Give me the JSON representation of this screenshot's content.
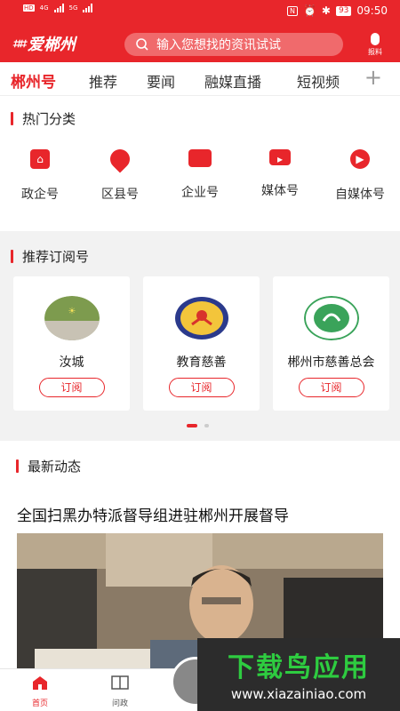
{
  "status_bar": {
    "net1": "4G",
    "net2": "5G",
    "hd1": "HD",
    "hd2": "HD",
    "battery": "93",
    "time": "09:50"
  },
  "header": {
    "logo_text": "爱郴州",
    "search_placeholder": "输入您想找的资讯试试",
    "report_label": "报料"
  },
  "tabs": [
    "郴州号",
    "推荐",
    "要闻",
    "融媒直播",
    "短视频"
  ],
  "hot": {
    "title": "热门分类",
    "categories": [
      {
        "label": "政企号",
        "icon": "building-icon"
      },
      {
        "label": "区县号",
        "icon": "location-pin-icon"
      },
      {
        "label": "企业号",
        "icon": "briefcase-icon"
      },
      {
        "label": "媒体号",
        "icon": "video-camera-icon"
      },
      {
        "label": "自媒体号",
        "icon": "play-icon"
      }
    ]
  },
  "recommend": {
    "title": "推荐订阅号",
    "subscribe_label": "订阅",
    "accounts": [
      {
        "name": "汝城"
      },
      {
        "name": "教育慈善"
      },
      {
        "name": "郴州市慈善总会"
      }
    ]
  },
  "news": {
    "title": "最新动态",
    "headline": "全国扫黑办特派督导组进驻郴州开展督导"
  },
  "bottom_nav": [
    {
      "label": "首页",
      "icon": "home-icon"
    },
    {
      "label": "问政",
      "icon": "book-icon"
    }
  ],
  "watermark": {
    "title": "下载鸟应用",
    "url": "www.xiazainiao.com"
  },
  "colors": {
    "accent": "#e8262b"
  }
}
